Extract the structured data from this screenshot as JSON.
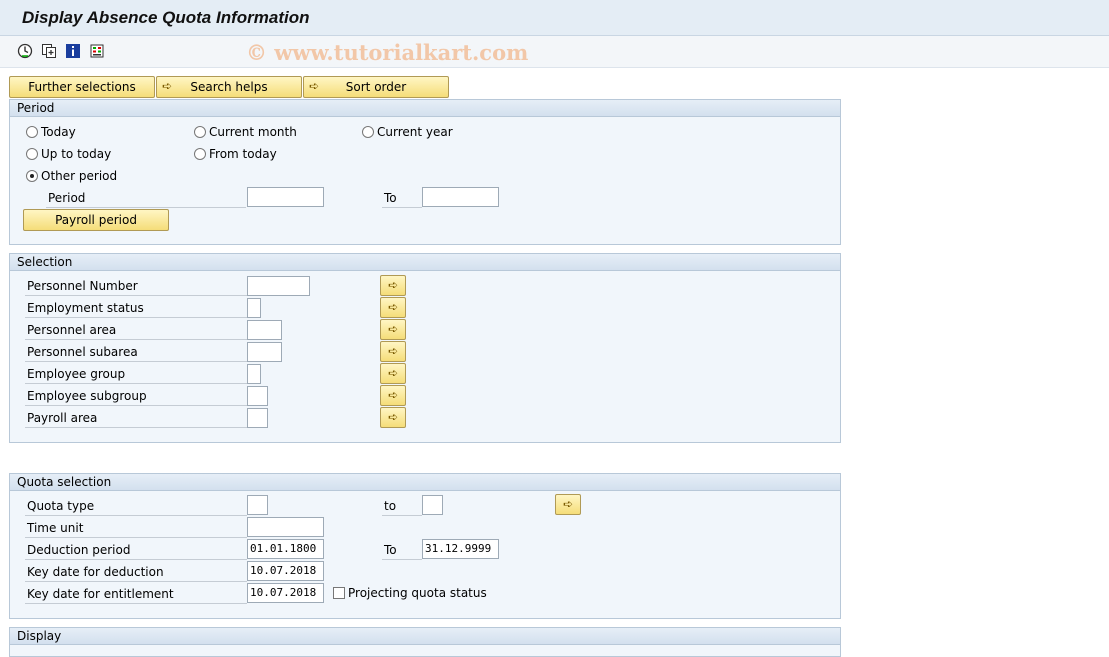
{
  "title": "Display Absence Quota Information",
  "watermark": "© www.tutorialkart.com",
  "toolbar_icons": [
    "execute-icon",
    "copy-icon",
    "info-icon",
    "selection-options-icon"
  ],
  "top_buttons": {
    "further_selections": "Further selections",
    "search_helps": "Search helps",
    "sort_order": "Sort order"
  },
  "period": {
    "header": "Period",
    "today": "Today",
    "current_month": "Current month",
    "current_year": "Current year",
    "up_to_today": "Up to today",
    "from_today": "From today",
    "other_period": "Other period",
    "selected": "other_period",
    "period_label": "Period",
    "period_from": "",
    "to_label": "To",
    "period_to": "",
    "payroll_period": "Payroll period"
  },
  "selection": {
    "header": "Selection",
    "rows": [
      {
        "label": "Personnel Number",
        "value": ""
      },
      {
        "label": "Employment status",
        "value": ""
      },
      {
        "label": "Personnel area",
        "value": ""
      },
      {
        "label": "Personnel subarea",
        "value": ""
      },
      {
        "label": "Employee group",
        "value": ""
      },
      {
        "label": "Employee subgroup",
        "value": ""
      },
      {
        "label": "Payroll area",
        "value": ""
      }
    ]
  },
  "quota": {
    "header": "Quota selection",
    "quota_type_label": "Quota type",
    "quota_type_from": "",
    "to_lower": "to",
    "quota_type_to": "",
    "time_unit_label": "Time unit",
    "time_unit": "",
    "deduction_period_label": "Deduction period",
    "deduction_from": "01.01.1800",
    "to_label": "To",
    "deduction_to": "31.12.9999",
    "key_date_deduction_label": "Key date for deduction",
    "key_date_deduction": "10.07.2018",
    "key_date_entitlement_label": "Key date for entitlement",
    "key_date_entitlement": "10.07.2018",
    "projecting_label": "Projecting quota status",
    "projecting_checked": false
  },
  "display": {
    "header": "Display"
  }
}
